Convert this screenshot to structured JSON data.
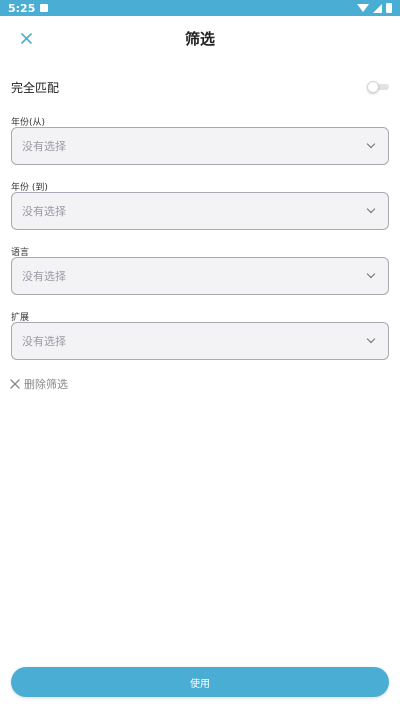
{
  "status_bar": {
    "time": "5:25"
  },
  "header": {
    "title": "筛选"
  },
  "exact_match": {
    "label": "完全匹配",
    "enabled": false
  },
  "filters": [
    {
      "label": "年份(从)",
      "value": "没有选择"
    },
    {
      "label": "年份 (到)",
      "value": "没有选择"
    },
    {
      "label": "语言",
      "value": "没有选择"
    },
    {
      "label": "扩展",
      "value": "没有选择"
    }
  ],
  "clear": {
    "label": "删除筛选"
  },
  "apply": {
    "label": "使用"
  },
  "colors": {
    "accent": "#4aaed4",
    "field_bg": "#f3f3f6",
    "field_border": "#a9a9b4"
  },
  "icons": {
    "close": "close-icon",
    "chevron": "chevron-down-icon"
  }
}
